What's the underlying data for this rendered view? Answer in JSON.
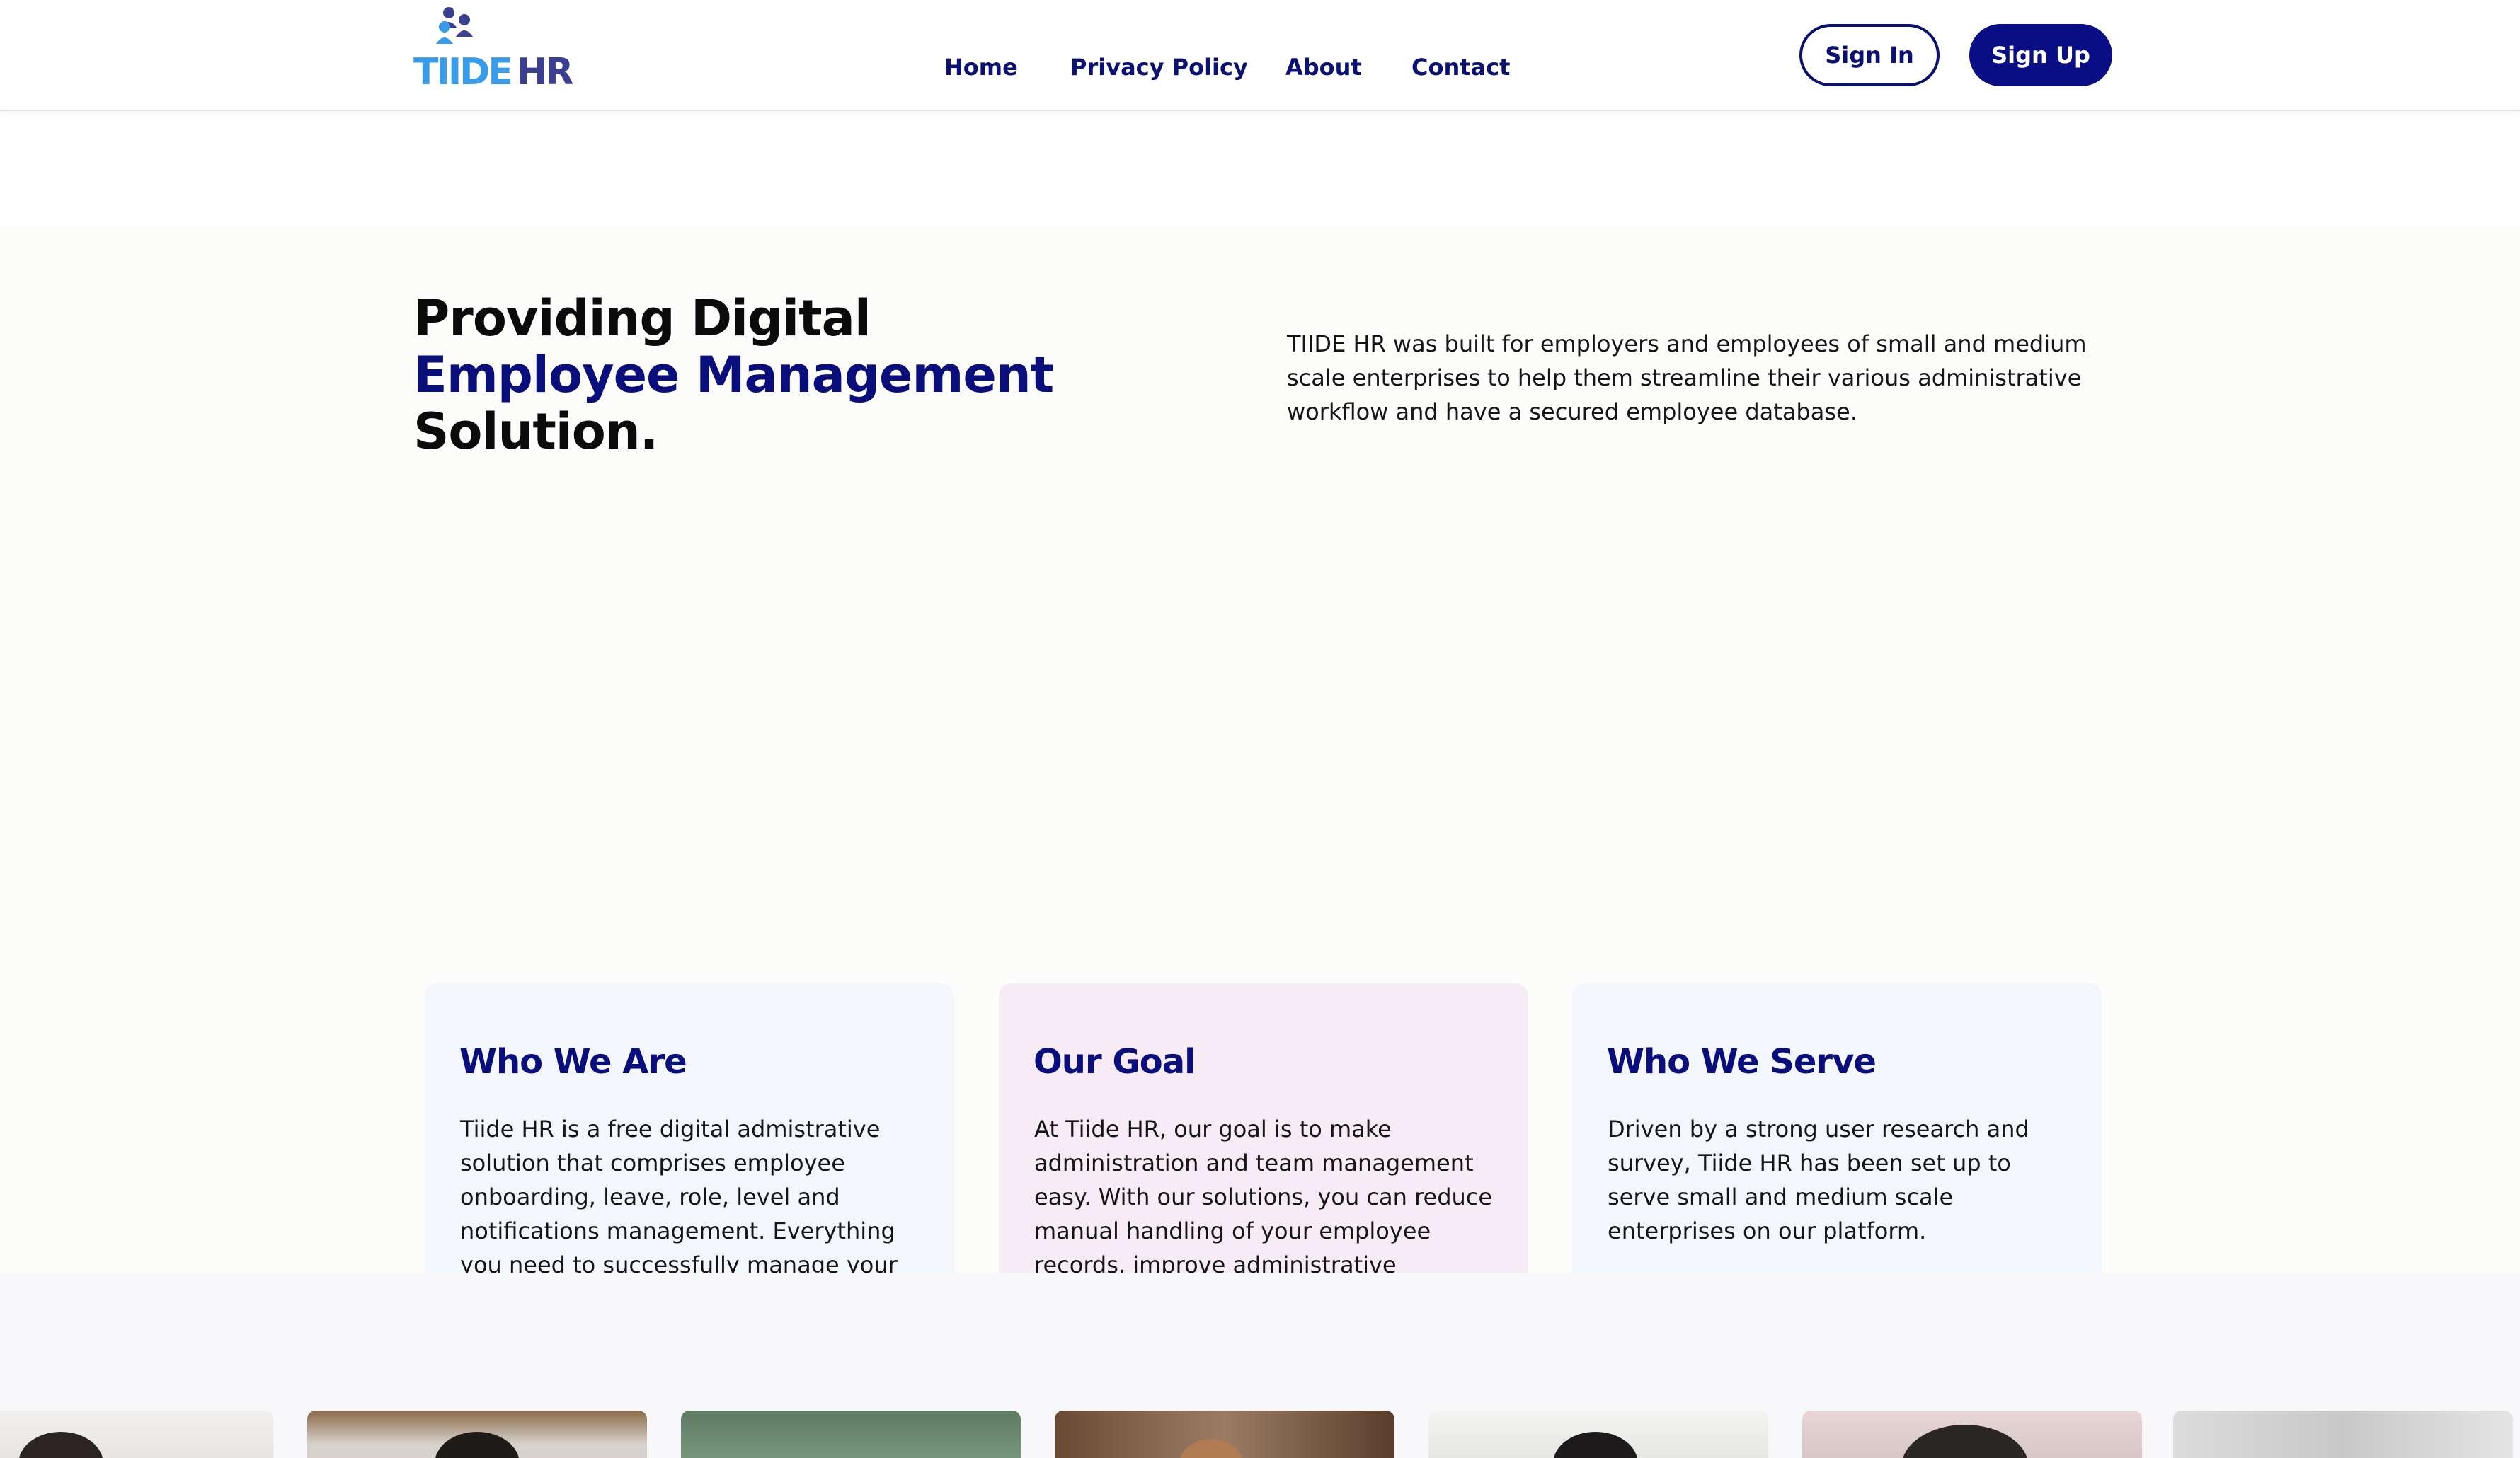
{
  "header": {
    "logo": {
      "brand": "TIIDE",
      "suffix": "HR"
    },
    "nav": [
      {
        "label": "Home"
      },
      {
        "label": "Privacy Policy"
      },
      {
        "label": "About"
      },
      {
        "label": "Contact"
      }
    ],
    "sign_in_label": "Sign In",
    "sign_up_label": "Sign Up"
  },
  "hero": {
    "title_line1": "Providing Digital",
    "title_line2": "Employee Management",
    "title_line3": "Solution.",
    "description": "TIIDE HR was built for employers and employees of small and medium scale enterprises to help them streamline their various administrative workflow and have a secured employee database."
  },
  "cards": [
    {
      "title": "Who We Are",
      "body": "Tiide HR is a free digital admistrative solution that comprises employee onboarding, leave, role, level and notifications management. Everything you need to successfully manage your employees all in one place."
    },
    {
      "title": "Our Goal",
      "body": "At Tiide HR, our goal is to make administration and team management easy. With our solutions, you can reduce manual handling of your employee records, improve administrative efficiency and also improve employee productivity."
    },
    {
      "title": "Who We Serve",
      "body": "Driven by a strong user research and survey, Tiide HR has been set up to serve small and medium scale enterprises on our platform."
    }
  ],
  "colors": {
    "brand_navy": "#0a1172",
    "brand_blue": "#3a9be8",
    "card_blue": "#f3f6fc",
    "card_pink": "#f7ebf5"
  },
  "team_photos": [
    {
      "name": "team-photo-1"
    },
    {
      "name": "team-photo-2"
    },
    {
      "name": "team-photo-3"
    },
    {
      "name": "team-photo-4"
    },
    {
      "name": "team-photo-5"
    },
    {
      "name": "team-photo-6"
    },
    {
      "name": "team-photo-7"
    }
  ]
}
